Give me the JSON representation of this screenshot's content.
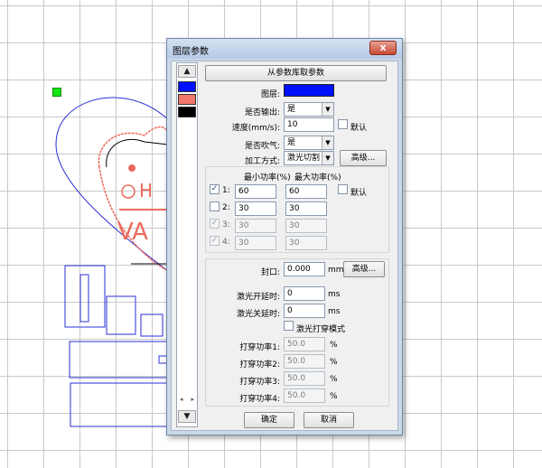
{
  "dialog": {
    "title": "图层参数",
    "close_glyph": "x",
    "load_from_library_button": "从参数库取参数",
    "layer_label": "图层:",
    "layer_color": "#0010ff",
    "output_label": "是否输出:",
    "output_value": "是",
    "speed_label": "速度(mm/s):",
    "speed_value": "10",
    "speed_default_label": "默认",
    "blow_label": "是否吹气:",
    "blow_value": "是",
    "process_label": "加工方式:",
    "process_value": "激光切割",
    "advanced_button": "高级...",
    "min_power_header": "最小功率(%)",
    "max_power_header": "最大功率(%)",
    "power_default_label": "默认",
    "power_rows": [
      {
        "label": "1:",
        "checked": true,
        "enabled": true,
        "min": "60",
        "max": "60"
      },
      {
        "label": "2:",
        "checked": false,
        "enabled": true,
        "min": "30",
        "max": "30"
      },
      {
        "label": "3:",
        "checked": true,
        "enabled": false,
        "min": "30",
        "max": "30"
      },
      {
        "label": "4:",
        "checked": true,
        "enabled": false,
        "min": "30",
        "max": "30"
      }
    ],
    "seal_label": "封口:",
    "seal_value": "0.000",
    "seal_unit": "mm",
    "seal_advanced_button": "高级...",
    "laser_on_delay_label": "激光开延时:",
    "laser_on_delay_value": "0",
    "laser_off_delay_label": "激光关延时:",
    "laser_off_delay_value": "0",
    "delay_unit": "ms",
    "pierce_mode_label": "激光打穿模式",
    "pierce_rows": [
      {
        "label": "打穿功率1:",
        "value": "50.0",
        "unit": "%"
      },
      {
        "label": "打穿功率2:",
        "value": "50.0",
        "unit": "%"
      },
      {
        "label": "打穿功率3:",
        "value": "50.0",
        "unit": "%"
      },
      {
        "label": "打穿功率4:",
        "value": "50.0",
        "unit": "%"
      }
    ],
    "ok_button": "确定",
    "cancel_button": "取消"
  },
  "layers": [
    {
      "color": "#0010ff",
      "selected": true
    },
    {
      "color": "#f2776a",
      "selected": false
    },
    {
      "color": "#000000",
      "selected": false
    }
  ],
  "canvas": {
    "art_text_1": "H",
    "art_text_2": "VA",
    "outline_color": "#2a2fd6",
    "accent_color": "#ec6a5c"
  }
}
